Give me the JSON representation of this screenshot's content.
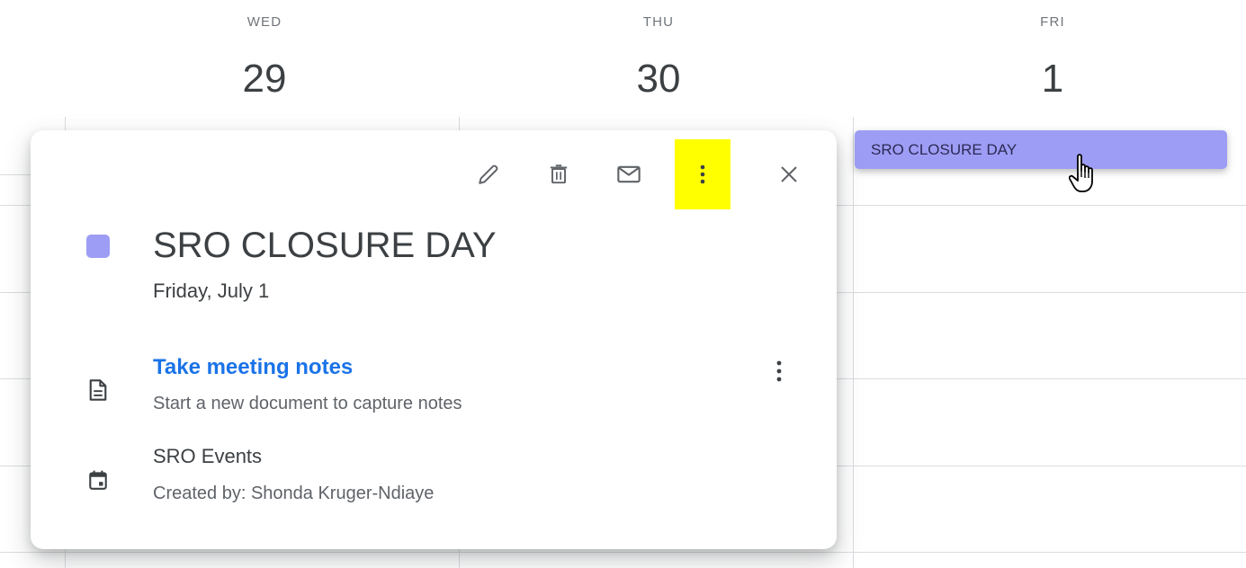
{
  "days": [
    {
      "name": "WED",
      "number": "29"
    },
    {
      "name": "THU",
      "number": "30"
    },
    {
      "name": "FRI",
      "number": "1"
    }
  ],
  "event_chip": {
    "label": "SRO CLOSURE DAY",
    "color": "#9e9df5"
  },
  "popup": {
    "toolbar": {
      "edit_icon": "pencil-icon",
      "delete_icon": "trash-icon",
      "email_icon": "envelope-icon",
      "more_icon": "more-vert-icon",
      "close_icon": "close-icon"
    },
    "title": "SRO CLOSURE DAY",
    "date": "Friday, July 1",
    "color": "#9e9df5",
    "notes": {
      "icon": "document-icon",
      "link": "Take meeting notes",
      "subtitle": "Start a new document to capture notes",
      "more_icon": "more-vert-icon"
    },
    "calendar": {
      "icon": "calendar-icon",
      "name": "SRO Events",
      "created_by": "Created by: Shonda Kruger-Ndiaye"
    }
  },
  "colors": {
    "accent_link": "#1a73e8",
    "highlight": "#ffff00",
    "grid_line": "#dadce0"
  }
}
